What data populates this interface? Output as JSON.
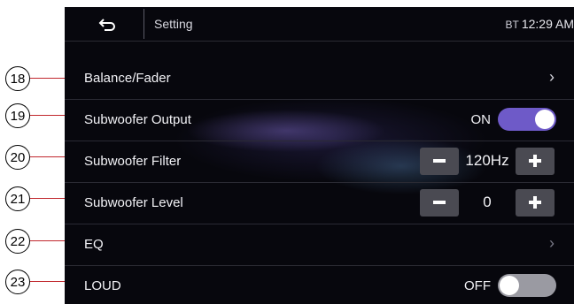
{
  "callouts": [
    "18",
    "19",
    "20",
    "21",
    "22",
    "23"
  ],
  "header": {
    "title": "Setting",
    "bt_label": "BT",
    "time": "12:29 AM"
  },
  "rows": {
    "balance": {
      "label": "Balance/Fader",
      "chevron": "›"
    },
    "sub_output": {
      "label": "Subwoofer Output",
      "state": "ON",
      "toggle_on": true,
      "accent": "#6e5ac8"
    },
    "sub_filter": {
      "label": "Subwoofer Filter",
      "value": "120Hz"
    },
    "sub_level": {
      "label": "Subwoofer Level",
      "value": "0"
    },
    "eq": {
      "label": "EQ",
      "chevron": "›"
    },
    "loud": {
      "label": "LOUD",
      "state": "OFF",
      "toggle_on": false,
      "off_color": "#9a9aa2"
    }
  },
  "icons": {
    "back": "back-arrow-icon",
    "minus": "minus-icon",
    "plus": "plus-icon",
    "chevron": "chevron-right-icon"
  }
}
